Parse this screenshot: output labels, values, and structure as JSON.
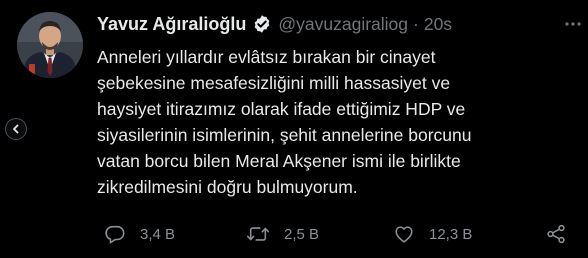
{
  "tweet": {
    "display_name": "Yavuz Ağıralioğlu",
    "handle": "@yavuzagiraliog",
    "separator": "·",
    "time": "20s",
    "text": "Anneleri yıllardır evlâtsız bırakan bir cinayet\nşebekesine mesafesizliğini milli hassasiyet ve\nhaysiyet itirazımız olarak ifade ettiğimiz HDP ve\nsiyasilerinin isimlerinin, şehit annelerine borcunu\nvatan borcu bilen Meral Akşener ismi ile birlikte\nzikredilmesini doğru bulmuyorum."
  },
  "actions": {
    "replies": "3,4 B",
    "retweets": "2,5 B",
    "likes": "12,3 B"
  },
  "icons": {
    "verified": "verified-badge-icon",
    "more": "more-options-icon",
    "prev": "chevron-left-icon",
    "reply": "reply-icon",
    "retweet": "retweet-icon",
    "like": "heart-icon",
    "share": "share-icon"
  },
  "colors": {
    "background": "#000000",
    "text": "#e7e9ea",
    "secondary": "#71767b",
    "icon": "#8b9096"
  }
}
